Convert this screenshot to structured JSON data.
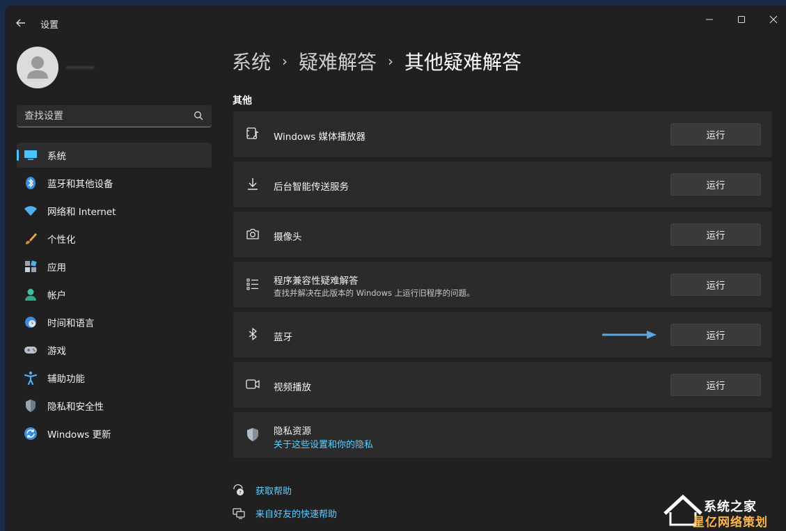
{
  "window": {
    "title": "设置",
    "controls": [
      "minimize-icon",
      "maximize-icon",
      "close-icon"
    ]
  },
  "search": {
    "placeholder": "查找设置"
  },
  "sidebar": {
    "items": [
      {
        "label": "系统",
        "icon": "system-icon",
        "active": true
      },
      {
        "label": "蓝牙和其他设备",
        "icon": "bluetooth-icon"
      },
      {
        "label": "网络和 Internet",
        "icon": "wifi-icon"
      },
      {
        "label": "个性化",
        "icon": "brush-icon"
      },
      {
        "label": "应用",
        "icon": "apps-icon"
      },
      {
        "label": "帐户",
        "icon": "account-icon"
      },
      {
        "label": "时间和语言",
        "icon": "globe-clock-icon"
      },
      {
        "label": "游戏",
        "icon": "gamepad-icon"
      },
      {
        "label": "辅助功能",
        "icon": "accessibility-icon"
      },
      {
        "label": "隐私和安全性",
        "icon": "shield-icon"
      },
      {
        "label": "Windows 更新",
        "icon": "update-icon"
      }
    ]
  },
  "breadcrumb": {
    "items": [
      "系统",
      "疑难解答"
    ],
    "current": "其他疑难解答"
  },
  "section": {
    "title": "其他"
  },
  "troubleshooters": [
    {
      "title": "Windows 媒体播放器",
      "icon": "media-player-icon",
      "button": "运行"
    },
    {
      "title": "后台智能传送服务",
      "icon": "download-icon",
      "button": "运行"
    },
    {
      "title": "摄像头",
      "icon": "camera-icon",
      "button": "运行"
    },
    {
      "title": "程序兼容性疑难解答",
      "desc": "查找并解决在此版本的 Windows 上运行旧程序的问题。",
      "icon": "list-icon",
      "button": "运行"
    },
    {
      "title": "蓝牙",
      "icon": "bluetooth-icon",
      "button": "运行"
    },
    {
      "title": "视频播放",
      "icon": "video-icon",
      "button": "运行"
    }
  ],
  "privacy": {
    "title": "隐私资源",
    "link": "关于这些设置和你的隐私",
    "icon": "shield-icon"
  },
  "help": {
    "get_help": "获取帮助",
    "quick_assist": "来自好友的快速帮助"
  },
  "watermark": {
    "line1": "系统之家",
    "line2": "星亿网络策划"
  },
  "colors": {
    "accent": "#4cc2ff",
    "link": "#60cdff",
    "background": "#202020",
    "card": "#2b2b2b"
  }
}
